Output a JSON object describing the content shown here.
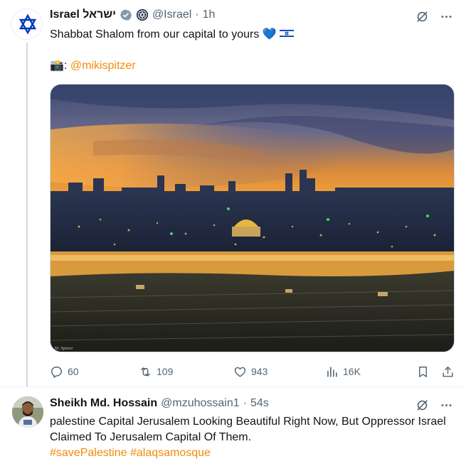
{
  "post1": {
    "author_name": "Israel ישראל",
    "handle": "@Israel",
    "separator": "·",
    "time": "1h",
    "text": "Shabbat Shalom from our capital to yours",
    "emoji_heart": "💙",
    "camera_emoji": "📸",
    "credit_prefix": ":",
    "credit_mention": "@mikispitzer",
    "image_watermark": "M. Spitzer",
    "stats": {
      "replies": "60",
      "reposts": "109",
      "likes": "943",
      "views": "16K"
    }
  },
  "post2": {
    "author_name": "Sheikh Md. Hossain",
    "handle": "@mzuhossain1",
    "separator": "·",
    "time": "54s",
    "text": "palestine Capital Jerusalem Looking Beautiful Right Now, But Oppressor Israel Claimed To Jerusalem Capital Of Them.",
    "hashtag1": "#savePalestine",
    "hashtag2": "#alaqsamosque"
  },
  "colors": {
    "link": "#f58a07",
    "secondary_text": "#536471",
    "verified_badge": "#829aab",
    "israel_blue": "#0038b8"
  }
}
